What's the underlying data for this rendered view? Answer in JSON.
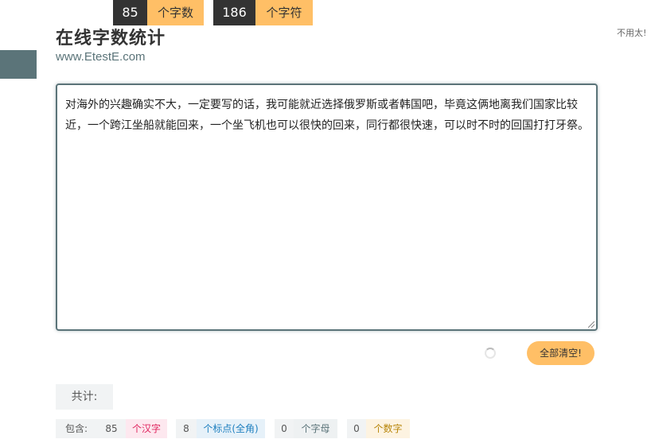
{
  "header": {
    "title": "在线字数统计",
    "subtitle": "www.EtestE.com",
    "top_right_text": "不用太!"
  },
  "editor": {
    "content": "对海外的兴趣确实不大，一定要写的话，我可能就近选择俄罗斯或者韩国吧，毕竟这俩地离我们国家比较近，一个跨江坐船就能回来，一个坐飞机也可以很快的回来，同行都很快速，可以时不时的回国打打牙祭。"
  },
  "actions": {
    "clear_all_label": "全部清空!"
  },
  "summary": {
    "label": "共计:",
    "char_count": "85",
    "char_unit": "个字数",
    "symbol_count": "186",
    "symbol_unit": "个字符"
  },
  "details": {
    "label": "包含:",
    "items": [
      {
        "count": "85",
        "unit": "个汉字",
        "color": "#e0245e",
        "bg": "#fde8ef"
      },
      {
        "count": "8",
        "unit": "个标点(全角)",
        "color": "#1d7fbf",
        "bg": "#e6f1f9"
      },
      {
        "count": "0",
        "unit": "个字母",
        "color": "#5b7479",
        "bg": "#eef1f2"
      },
      {
        "count": "0",
        "unit": "个数字",
        "color": "#b8860b",
        "bg": "#fdf3e1"
      }
    ]
  },
  "colors": {
    "accent": "#5b7479",
    "orange": "#ffbf66",
    "dark": "#333333"
  }
}
